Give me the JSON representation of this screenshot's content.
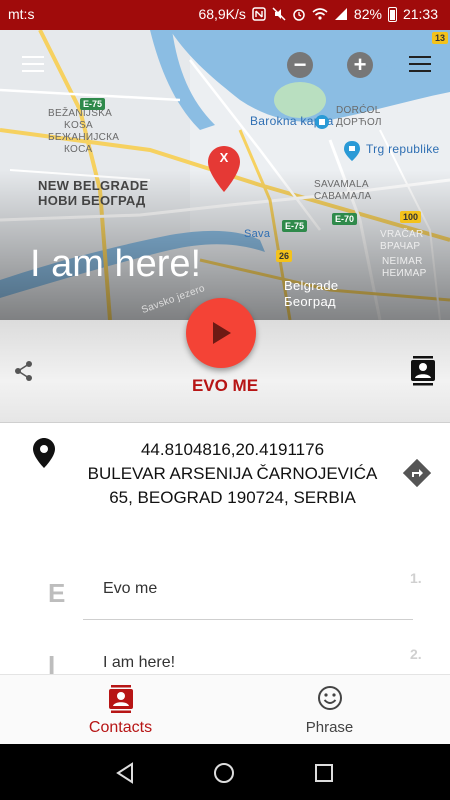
{
  "status_bar": {
    "carrier": "mt:s",
    "speed": "68,9K/s",
    "battery": "82%",
    "time": "21:33"
  },
  "map": {
    "labels": {
      "barokna_kapija": "Barokna kapija",
      "dorcol": "DORĆOL",
      "dorcol_cyr": "ДОРЋОЛ",
      "trg_republike": "Trg republike",
      "bezanijska_kosa": "BEŽANIJSKA",
      "bezanijska_kosa2": "KOSA",
      "bezanijska_kosa_cyr": "БЕЖАНИЈСКА",
      "bezanijska_kosa_cyr2": "КОСА",
      "new_belgrade": "NEW BELGRADE",
      "new_belgrade_cyr": "НОВИ БЕОГРАД",
      "savamala": "SAVAMALA",
      "savamala_cyr": "САВАМАЛА",
      "sava": "Sava",
      "vracar": "VRAČAR",
      "vracar_cyr": "ВРАЧАР",
      "neimar": "NEIMAR",
      "neimar_cyr": "НЕИМАР",
      "belgrade": "Belgrade",
      "belgrade_cyr": "Београд",
      "savski": "Savsko jezero"
    },
    "shields": {
      "e75_a": "E-75",
      "e75_b": "E-75",
      "e70": "E-70",
      "r13": "13",
      "r100": "100",
      "r26": "26"
    },
    "pin_letter": "X",
    "overlay_title": "I am here!"
  },
  "action_band": {
    "button_label": "EVO ME"
  },
  "location": {
    "coordinates": "44.8104816,20.4191176",
    "address_line1": "BULEVAR ARSENIJA ČARNOJEVIĆA",
    "address_line2": "65, BEOGRAD 190724, SERBIA"
  },
  "phrases": [
    {
      "letter": "E",
      "text": "Evo me",
      "number": "1."
    },
    {
      "letter": "I",
      "text": "I am here!",
      "number": "2."
    }
  ],
  "bottom_nav": {
    "contacts_label": "Contacts",
    "phrase_label": "Phrase"
  },
  "colors": {
    "status_bar": "#a00b0b",
    "accent": "#b71515",
    "fab": "#f44336"
  }
}
